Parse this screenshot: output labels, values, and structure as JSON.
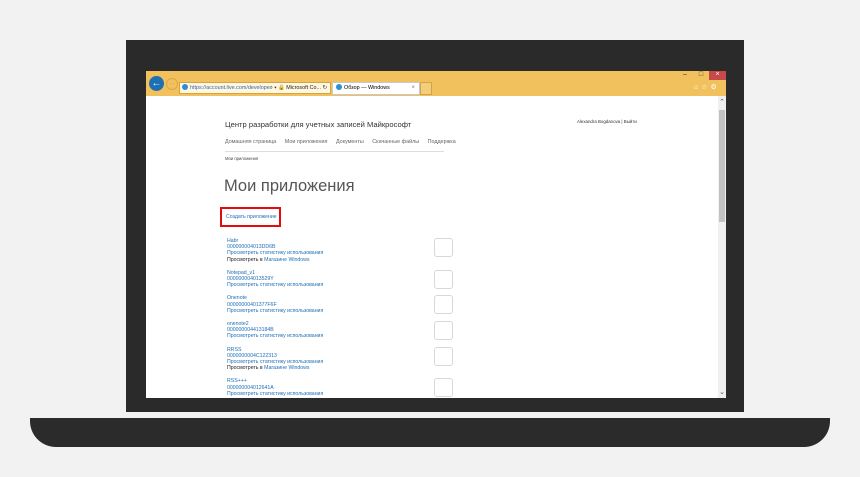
{
  "browser": {
    "address_url": "https://account.live.com/develope",
    "address_tail": "⌕ ▾ 🔒 Microsoft Co... ↻",
    "tab_title": "Обзор — Windows",
    "tab_close": "×",
    "back_glyph": "←",
    "forward_glyph": "→",
    "window_controls": {
      "minimize": "–",
      "maximize": "□",
      "close": "×"
    },
    "toolbar_icons": "⌂☆⚙"
  },
  "header": {
    "user_links": "Alexandra Bogdanova | Выйти",
    "site_title": "Центр разработки для учетных записей Майкрософт"
  },
  "nav": {
    "items": [
      "Домашняя страница",
      "Мои приложения",
      "Документы",
      "Скачанные файлы",
      "Поддержка"
    ]
  },
  "breadcrumb": "Мои приложения",
  "page_title": "Мои приложения",
  "create_app": "Создать приложение",
  "stats_label": "Просмотреть статистику использования",
  "view_in_label": "Просмотреть в",
  "store_label": "Магазине Windows",
  "apps": [
    {
      "name": "Habr",
      "id": "000000004013DD6B",
      "store": true
    },
    {
      "name": "Notepad_v1",
      "id": "000000004013529Y",
      "store": false
    },
    {
      "name": "Onenote",
      "id": "00000000401377F6F",
      "store": false
    },
    {
      "name": "onenote2",
      "id": "000000004413184B",
      "store": false
    },
    {
      "name": "RRSS",
      "id": "0000000004C122313",
      "store": true
    },
    {
      "name": "RSS+++",
      "id": "000000004012641A",
      "store": false
    }
  ],
  "colors": {
    "chrome": "#f1c15e",
    "link": "#1f6fb5",
    "highlight": "#e20c0c"
  }
}
